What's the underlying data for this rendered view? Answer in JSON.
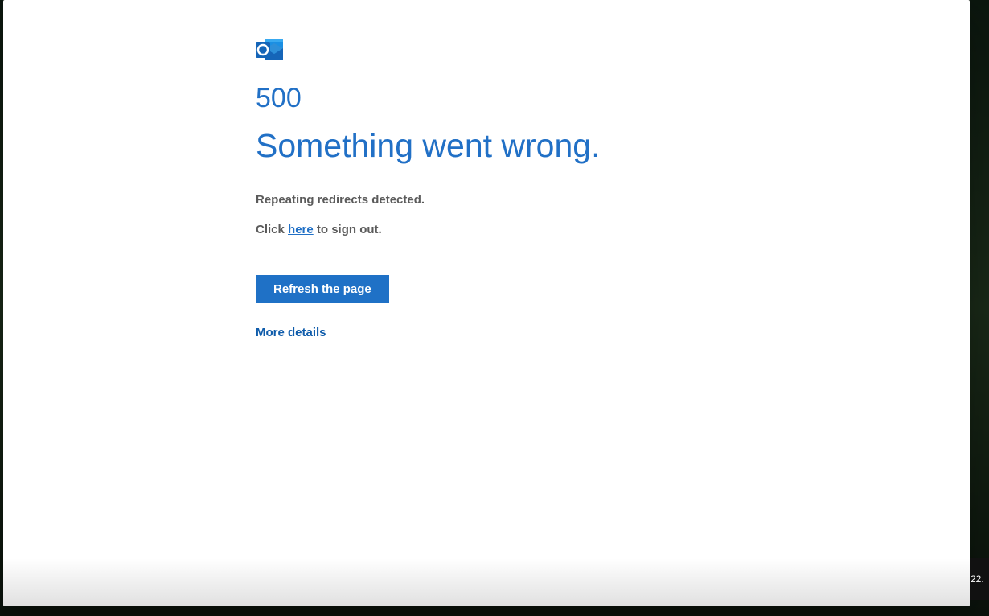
{
  "error": {
    "code": "500",
    "heading": "Something went wrong.",
    "message": "Repeating redirects detected.",
    "signout_prefix": "Click ",
    "signout_link": "here",
    "signout_suffix": " to sign out.",
    "refresh_label": "Refresh the page",
    "more_details_label": "More details"
  },
  "taskbar": {
    "clock_fragment": "22."
  }
}
